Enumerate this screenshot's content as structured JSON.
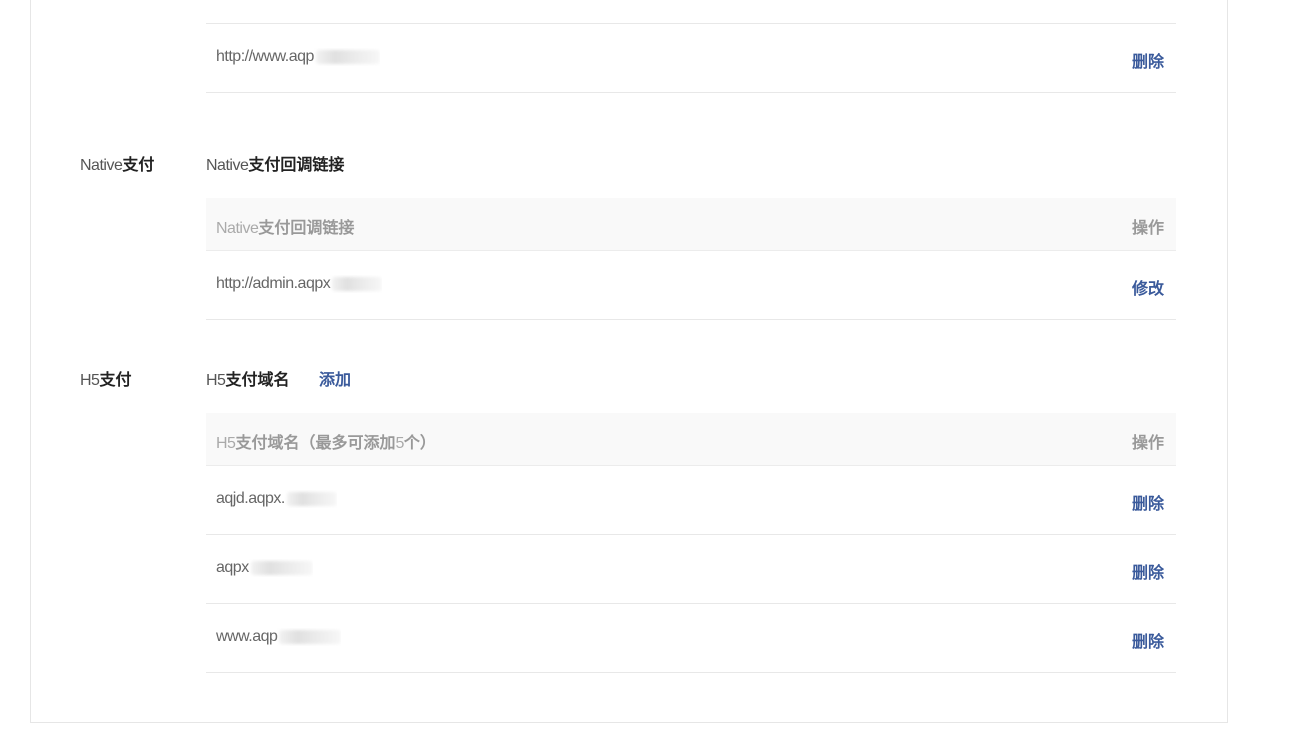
{
  "top_section": {
    "rows": [
      {
        "url": "http://www.aqp",
        "action": "删除"
      }
    ]
  },
  "native": {
    "label_latin": "Native",
    "label_cn": "支付",
    "title_latin": "Native",
    "title_cn": "支付回调链接",
    "table_header_latin": "Native",
    "table_header_cn": "支付回调链接",
    "table_header_action": "操作",
    "rows": [
      {
        "url": "http://admin.aqpx",
        "action": "修改"
      }
    ]
  },
  "h5": {
    "label_latin": "H5",
    "label_cn": "支付",
    "title_latin": "H5",
    "title_cn": "支付域名",
    "add_label": "添加",
    "table_header_latin": "H5",
    "table_header_cn": "支付域名（最多可添加",
    "table_header_num": "5",
    "table_header_tail": "个）",
    "table_header_action": "操作",
    "rows": [
      {
        "domain": "aqjd.aqpx.",
        "action": "删除"
      },
      {
        "domain": "aqpx",
        "action": "删除"
      },
      {
        "domain": "www.aqp",
        "action": "删除"
      }
    ]
  },
  "colors": {
    "link": "#3a5a9b",
    "header_bg": "#f9f9f9",
    "border": "#e8e8e8"
  }
}
